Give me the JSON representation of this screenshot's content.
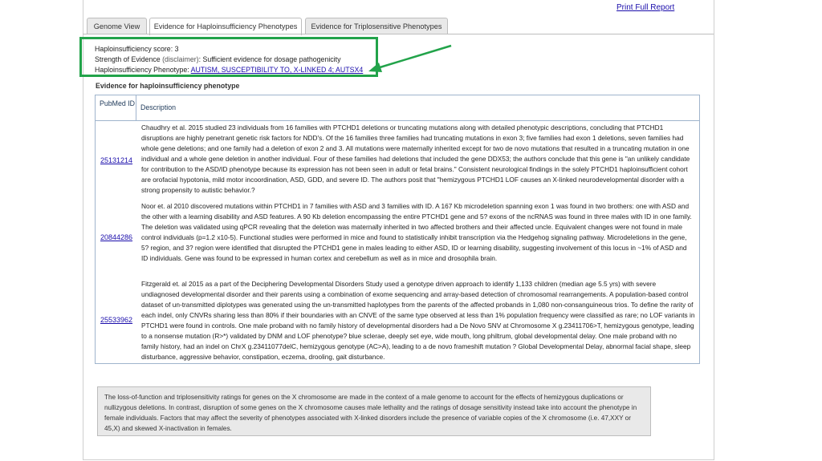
{
  "header": {
    "print_label": "Print Full Report"
  },
  "tabs": [
    {
      "label": "Genome View"
    },
    {
      "label": "Evidence for Haploinsufficiency Phenotypes"
    },
    {
      "label": "Evidence for Triplosensitive Phenotypes"
    }
  ],
  "summary": {
    "score_label": "Haploinsufficiency score:",
    "score_value": "3",
    "strength_label": "Strength of Evidence",
    "disclaimer": "(disclaimer)",
    "strength_value": "Sufficient evidence for dosage pathogenicity",
    "phenotype_label": "Haploinsufficiency Phenotype:",
    "phenotype_value": "AUTISM, SUSCEPTIBILITY TO, X-LINKED 4; AUTSX4"
  },
  "evidence": {
    "heading": "Evidence for haploinsufficiency phenotype",
    "col_pubmed": "PubMed ID",
    "col_description": "Description",
    "rows": [
      {
        "pmid": "25131214",
        "text": "Chaudhry et al. 2015 studied 23 individuals from 16 families with PTCHD1 deletions or truncating mutations along with detailed phenotypic descriptions, concluding that PTCHD1 disruptions are highly penetrant genetic risk factors for NDD's. Of the 16 families three families had truncating mutations in exon 3; five families had exon 1 deletions, seven families had whole gene deletions; and one family had a deletion of exon 2 and 3. All mutations were maternally inherited except for two de novo mutations that resulted in a truncating mutation in one individual and a whole gene deletion in another individual. Four of these families had deletions that included the gene DDX53; the authors conclude that this gene is \"an unlikely candidate for contribution to the ASD/ID phenotype because its expression has not been seen in adult or fetal brains.\" Consistent neurological findings in the solely PTCHD1 haploinsufficient cohort are orofacial hypotonia, mild motor incoordination, ASD, GDD, and severe ID. The authors posit that \"hemizygous PTCHD1 LOF causes an X-linked neurodevelopmental disorder with a strong propensity to autistic behavior.?"
      },
      {
        "pmid": "20844286",
        "text": "Noor et. al 2010 discovered mutations within PTCHD1 in 7 families with ASD and 3 families with ID. A 167 Kb microdeletion spanning exon 1 was found in two brothers: one with ASD and the other with a learning disability and ASD features. A 90 Kb deletion encompassing the entire PTCHD1 gene and 5? exons of the ncRNAS was found in three males with ID in one family. The deletion was validated using qPCR revealing that the deletion was maternally inherited in two affected brothers and their affected uncle. Equivalent changes were not found in male control individuals (p=1.2 x10-5). Functional studies were performed in mice and found to statistically inhibit transcription via the Hedgehog signaling pathway. Microdeletions in the gene, 5? region, and 3? region were identified that disrupted the PTCHD1 gene in males leading to either ASD, ID or learning disability, suggesting involvement of this locus in ~1% of ASD and ID individuals. Gene was found to be expressed in human cortex and cerebellum as well as in mice and drosophila brain."
      },
      {
        "pmid": "25533962",
        "text": "Fitzgerald et. al 2015 as a part of the Deciphering Developmental Disorders Study used a genotype driven approach to identify 1,133 children (median age 5.5 yrs) with severe undiagnosed developmental disorder and their parents using a combination of exome sequencing and array-based detection of chromosomal rearrangements. A population-based control dataset of un-transmitted diplotypes was generated using the un-transmitted haplotypes from the parents of the affected probands in 1,080 non-consanguineous trios. To define the rarity of each indel, only CNVRs sharing less than 80% if their boundaries with an CNVE of the same type observed at less than 1% population frequency were classified as rare; no LOF variants in PTCHD1 were found in controls. One male proband with no family history of developmental disorders had a De Novo SNV at Chromosome X g.23411706>T, hemizygous genotype, leading to a nonsense mutation (R>*) validated by DNM and LOF phenotype? blue sclerae, deeply set eye, wide mouth, long philtrum, global developmental delay. One male proband with no family history, had an indel on ChrX g.23411077delC, hemizygous genotype (AC>A), leading to a de novo frameshift mutation ? Global Developmental Delay, abnormal facial shape, sleep disturbance, aggressive behavior, constipation, eczema, drooling, gait disturbance."
      }
    ]
  },
  "note": {
    "text": "The loss-of-function and triplosensitivity ratings for genes on the X chromosome are made in the context of a male genome to account for the effects of hemizygous duplications or nullizygous deletions. In contrast, disruption of some genes on the X chromosome causes male lethality and the ratings of dosage sensitivity instead take into account the phenotype in female individuals. Factors that may affect the severity of phenotypes associated with X-linked disorders include the presence of variable copies of the X chromosome (i.e. 47,XXY or 45,X) and skewed X-inactivation in females."
  },
  "colors": {
    "highlight": "#22a34a",
    "link": "#1a0dab",
    "table_border": "#9fb4cc"
  }
}
